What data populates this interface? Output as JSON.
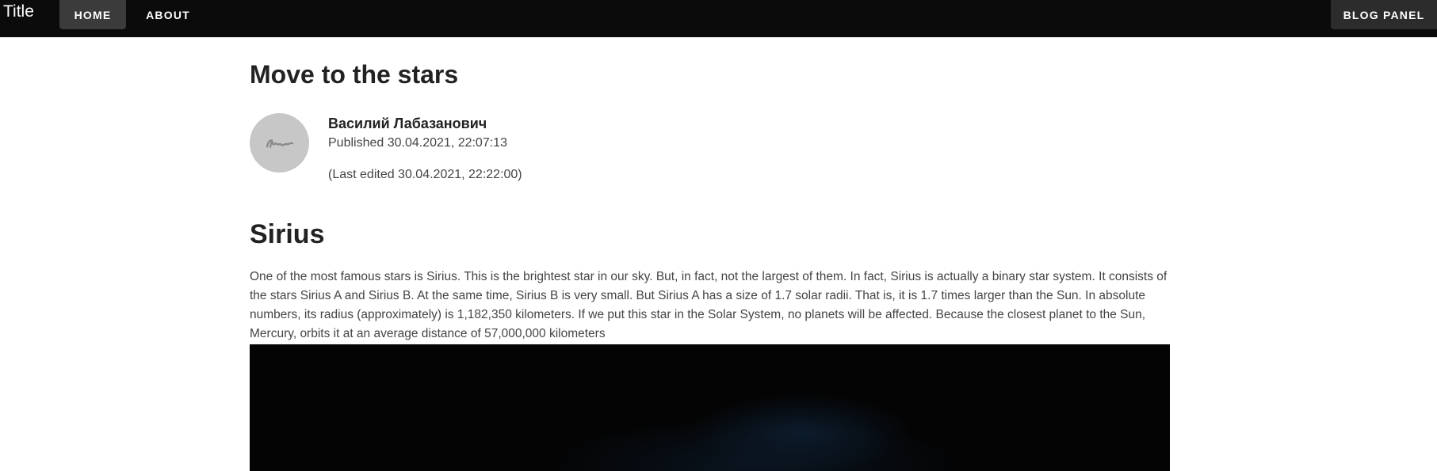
{
  "header": {
    "brand": "Title",
    "nav": {
      "home": "HOME",
      "about": "ABOUT",
      "panel": "BLOG PANEL"
    }
  },
  "post": {
    "title": "Move to the stars",
    "author": "Василий Лабазанович",
    "published": "Published 30.04.2021, 22:07:13",
    "edited": "(Last edited 30.04.2021, 22:22:00)",
    "section_heading": "Sirius",
    "body": "One of the most famous stars is Sirius. This is the brightest star in our sky. But, in fact, not the largest of them. In fact, Sirius is actually a binary star system. It consists of the stars Sirius A and Sirius B. At the same time, Sirius B is very small. But Sirius A has a size of 1.7 solar radii. That is, it is 1.7 times larger than the Sun. In absolute numbers, its radius (approximately) is 1,182,350 kilometers. If we put this star in the Solar System, no planets will be affected. Because the closest planet to the Sun, Mercury, orbits it at an average distance of 57,000,000 kilometers"
  },
  "icons": {
    "avatar": "signature-avatar-icon"
  },
  "colors": {
    "topbar": "#0b0b0b",
    "active_nav": "#3b3b3b",
    "avatar_bg": "#c7c7c7"
  }
}
